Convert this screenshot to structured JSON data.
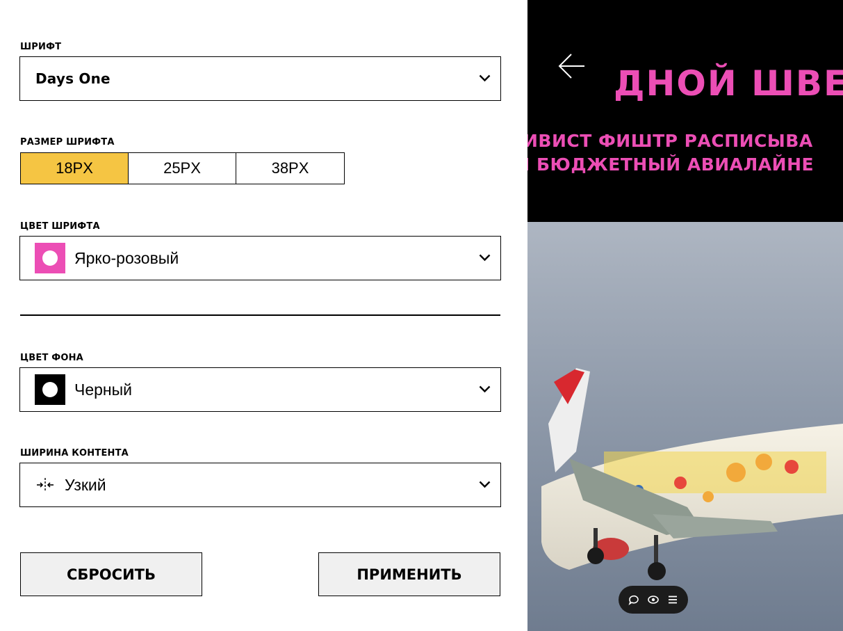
{
  "settings": {
    "font": {
      "label": "ШРИФТ",
      "value": "Days One"
    },
    "font_size": {
      "label": "РАЗМЕР ШРИФТА",
      "options": [
        "18PX",
        "25PX",
        "38PX"
      ],
      "selected": "18PX"
    },
    "font_color": {
      "label": "ЦВЕТ ШРИФТА",
      "value": "Ярко-розовый",
      "swatch": "#ec4eb5"
    },
    "bg_color": {
      "label": "ЦВЕТ ФОНА",
      "value": "Черный",
      "swatch": "#000000"
    },
    "content_width": {
      "label": "ШИРИНА КОНТЕНТА",
      "value": "Узкий",
      "icon": "narrow-width-icon"
    },
    "reset_label": "СБРОСИТЬ",
    "apply_label": "ПРИМЕНИТЬ"
  },
  "preview": {
    "title": "ДНОЙ ШВЕ",
    "subtitle_line1": "ИВИСТ ФИШТР РАСПИСЫВА",
    "subtitle_line2": "І БЮДЖЕТНЫЙ АВИАЛАЙНЕ",
    "image_icon": "airplane-photo",
    "pill_icons": [
      "comment-icon",
      "eye-icon",
      "menu-icon"
    ]
  },
  "colors": {
    "accent_yellow": "#f5c543",
    "accent_pink": "#ec4eb5",
    "preview_bg": "#000000"
  }
}
